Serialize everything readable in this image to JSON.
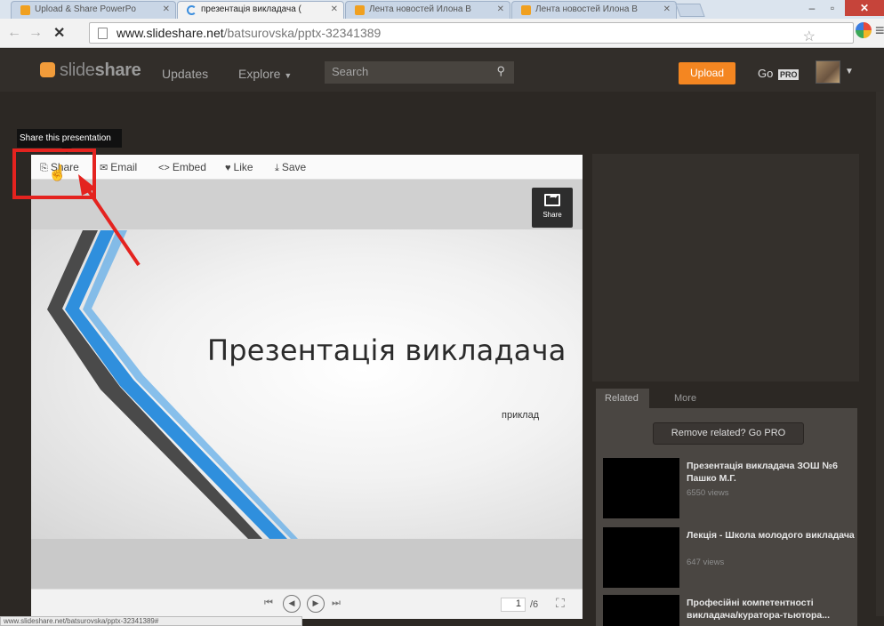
{
  "browser": {
    "tabs": [
      {
        "title": "Upload & Share PowerPo",
        "active": false
      },
      {
        "title": "презентація викладача (",
        "active": true
      },
      {
        "title": "Лента новостей Илона В",
        "active": false
      },
      {
        "title": "Лента новостей Илона В",
        "active": false
      }
    ],
    "url_host": "www.slideshare.net",
    "url_path": "/batsurovska/pptx-32341389",
    "status_url": "www.slideshare.net/batsurovska/pptx-32341389#"
  },
  "site_nav": {
    "logo_light": "slide",
    "logo_bold": "share",
    "updates": "Updates",
    "explore": "Explore",
    "search_placeholder": "Search",
    "upload": "Upload",
    "go": "Go",
    "pro": "PRO"
  },
  "tooltip": "Share this presentation",
  "actions": {
    "share": "Share",
    "email": "Email",
    "embed": "Embed",
    "like": "Like",
    "save": "Save"
  },
  "slide": {
    "title": "Презентація викладача",
    "subtitle": "приклад",
    "share_overlay": "Share"
  },
  "player": {
    "current_page": "1",
    "total_pages": "/6"
  },
  "related_panel": {
    "tab_related": "Related",
    "tab_more": "More",
    "remove_button": "Remove related? Go PRO",
    "items": [
      {
        "title": "Презентація викладача ЗОШ №6 Пашко М.Г.",
        "views": "6550 views"
      },
      {
        "title": "Лекція - Школа молодого викладача",
        "views": "647 views"
      },
      {
        "title": "Професійні компетентності викладача/куратора-тьютора...",
        "views": ""
      }
    ]
  }
}
